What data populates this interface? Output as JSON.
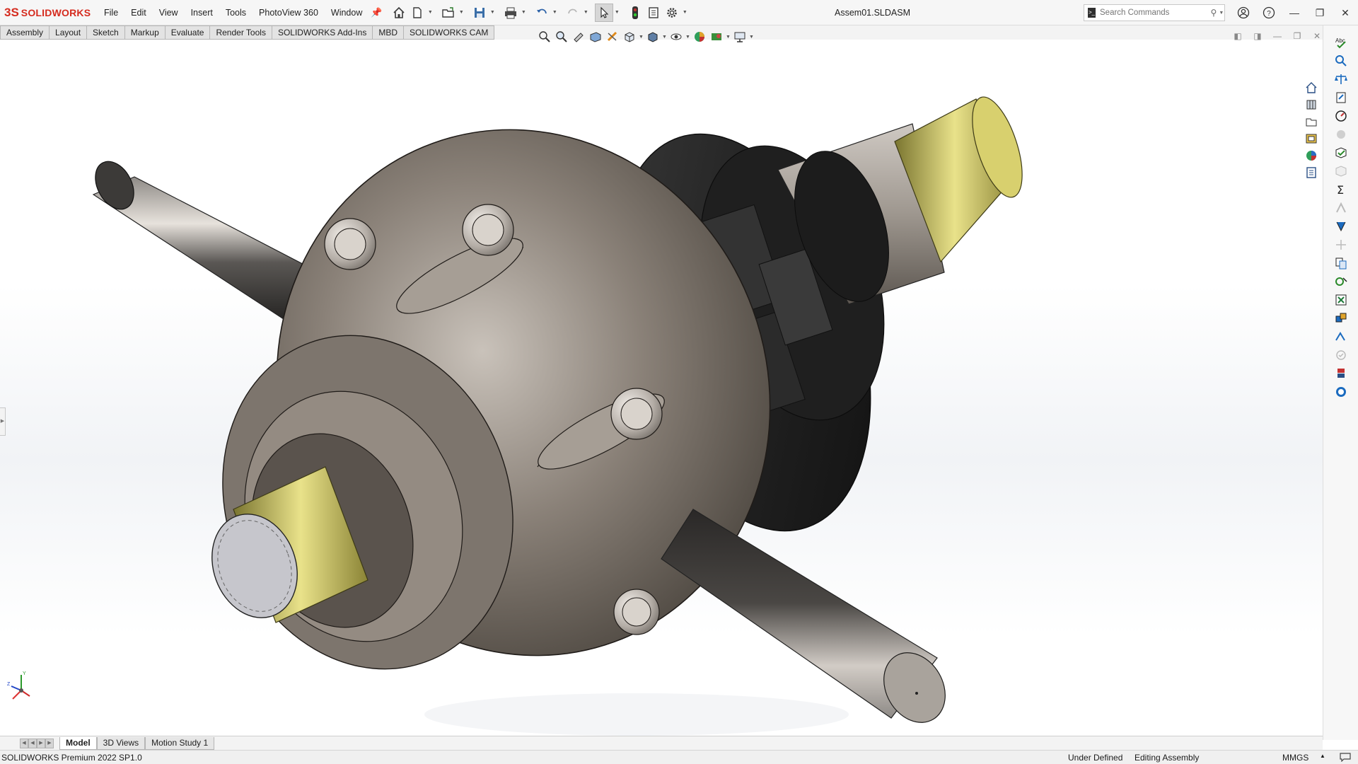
{
  "app": {
    "logo_mark": "3S",
    "logo_text": "SOLIDWORKS",
    "document_title": "Assem01.SLDASM"
  },
  "menu": {
    "items": [
      "File",
      "Edit",
      "View",
      "Insert",
      "Tools",
      "PhotoView 360",
      "Window"
    ]
  },
  "search": {
    "placeholder": "Search Commands"
  },
  "command_tabs": [
    "Assembly",
    "Layout",
    "Sketch",
    "Markup",
    "Evaluate",
    "Render Tools",
    "SOLIDWORKS Add-Ins",
    "MBD",
    "SOLIDWORKS CAM"
  ],
  "bottom_tabs": [
    "Model",
    "3D Views",
    "Motion Study 1"
  ],
  "status": {
    "product": "SOLIDWORKS Premium 2022 SP1.0",
    "definition": "Under Defined",
    "mode": "Editing Assembly",
    "units": "MMGS"
  },
  "triad": {
    "y_label": "Y",
    "z_label": "Z"
  },
  "colors": {
    "brand": "#d52b1e",
    "housing": "#8a8178",
    "flange": "#2e2e2e",
    "spline": "#c9c36a",
    "shaft": "#4a4744"
  }
}
